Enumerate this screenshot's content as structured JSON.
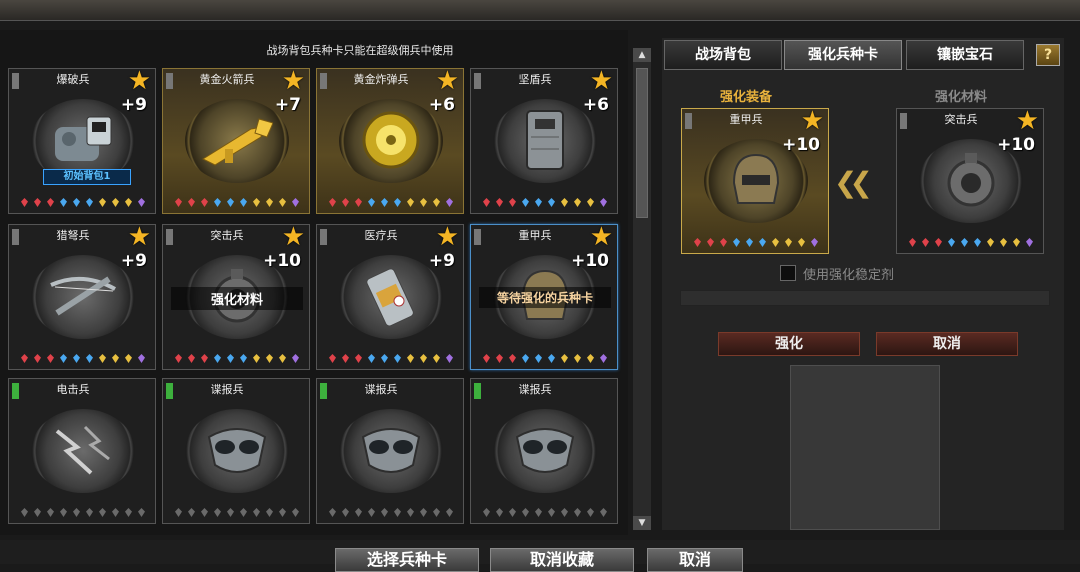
{
  "notice": "战场背包兵种卡只能在超级佣兵中使用",
  "gem_colors": {
    "red": "#e0424a",
    "blue": "#4aa8f0",
    "yellow": "#e8c040",
    "purple": "#a070e0",
    "dark": "#6a6a6a"
  },
  "cards": [
    {
      "name": "爆破兵",
      "level": "+9",
      "star": "★",
      "variant": "normal",
      "flag": "gray",
      "item": "backpack-bomb-icon",
      "bag_label": "初始背包1",
      "gems": [
        "red",
        "red",
        "red",
        "blue",
        "blue",
        "blue",
        "yellow",
        "yellow",
        "yellow",
        "purple"
      ]
    },
    {
      "name": "黄金火箭兵",
      "level": "+7",
      "star": "★",
      "variant": "gold",
      "flag": "gray",
      "item": "golden-rocket-launcher-icon",
      "gems": [
        "red",
        "red",
        "red",
        "blue",
        "blue",
        "blue",
        "yellow",
        "yellow",
        "yellow",
        "purple"
      ]
    },
    {
      "name": "黄金炸弹兵",
      "level": "+6",
      "star": "★",
      "variant": "gold",
      "flag": "gray",
      "item": "golden-mine-icon",
      "gems": [
        "red",
        "red",
        "red",
        "blue",
        "blue",
        "blue",
        "yellow",
        "yellow",
        "yellow",
        "purple"
      ]
    },
    {
      "name": "坚盾兵",
      "level": "+6",
      "star": "★",
      "variant": "normal",
      "flag": "gray",
      "item": "riot-shield-icon",
      "gems": [
        "red",
        "red",
        "red",
        "blue",
        "blue",
        "blue",
        "yellow",
        "yellow",
        "yellow",
        "purple"
      ]
    },
    {
      "name": "猎弩兵",
      "level": "+9",
      "star": "★",
      "variant": "normal",
      "flag": "gray",
      "item": "crossbow-icon",
      "gems": [
        "red",
        "red",
        "red",
        "blue",
        "blue",
        "blue",
        "yellow",
        "yellow",
        "yellow",
        "purple"
      ]
    },
    {
      "name": "突击兵",
      "level": "+10",
      "star": "★",
      "variant": "normal",
      "flag": "gray",
      "item": "assault-gear-icon",
      "tagline": "强化材料",
      "gems": [
        "red",
        "red",
        "red",
        "blue",
        "blue",
        "blue",
        "yellow",
        "yellow",
        "yellow",
        "purple"
      ]
    },
    {
      "name": "医疗兵",
      "level": "+9",
      "star": "★",
      "variant": "normal",
      "flag": "gray",
      "item": "medkit-canister-icon",
      "gems": [
        "red",
        "red",
        "red",
        "blue",
        "blue",
        "blue",
        "yellow",
        "yellow",
        "yellow",
        "purple"
      ]
    },
    {
      "name": "重甲兵",
      "level": "+10",
      "star": "★",
      "variant": "selected",
      "flag": "gray",
      "item": "heavy-armor-helmet-icon",
      "tagline": "等待强化的兵种卡",
      "gems": [
        "red",
        "red",
        "red",
        "blue",
        "blue",
        "blue",
        "yellow",
        "yellow",
        "yellow",
        "purple"
      ]
    },
    {
      "name": "电击兵",
      "level": "",
      "star": "",
      "variant": "normal",
      "flag": "green",
      "item": "electric-shock-icon",
      "gems": [
        "dark",
        "dark",
        "dark",
        "dark",
        "dark",
        "dark",
        "dark",
        "dark",
        "dark",
        "dark"
      ]
    },
    {
      "name": "谍报兵",
      "level": "",
      "star": "",
      "variant": "normal",
      "flag": "green",
      "item": "spy-mask-icon",
      "gems": [
        "dark",
        "dark",
        "dark",
        "dark",
        "dark",
        "dark",
        "dark",
        "dark",
        "dark",
        "dark"
      ]
    },
    {
      "name": "谍报兵",
      "level": "",
      "star": "",
      "variant": "normal",
      "flag": "green",
      "item": "spy-mask-icon",
      "gems": [
        "dark",
        "dark",
        "dark",
        "dark",
        "dark",
        "dark",
        "dark",
        "dark",
        "dark",
        "dark"
      ]
    },
    {
      "name": "谍报兵",
      "level": "",
      "star": "",
      "variant": "normal",
      "flag": "green",
      "item": "spy-mask-icon",
      "gems": [
        "dark",
        "dark",
        "dark",
        "dark",
        "dark",
        "dark",
        "dark",
        "dark",
        "dark",
        "dark"
      ]
    }
  ],
  "tabs": [
    "战场背包",
    "强化兵种卡",
    "镶嵌宝石"
  ],
  "help_label": "?",
  "enhance_label": "强化装备",
  "material_label": "强化材料",
  "enhance_slot": {
    "name": "重甲兵",
    "level": "+10",
    "star": "★"
  },
  "material_slot": {
    "name": "突击兵",
    "level": "+10",
    "star": "★"
  },
  "transfer_arrow": "❮❮",
  "stabilizer_label": "使用强化稳定剂",
  "enhance_button": "强化",
  "cancel_button": "取消",
  "bottom_buttons": [
    "选择兵种卡",
    "取消收藏",
    "取消"
  ]
}
